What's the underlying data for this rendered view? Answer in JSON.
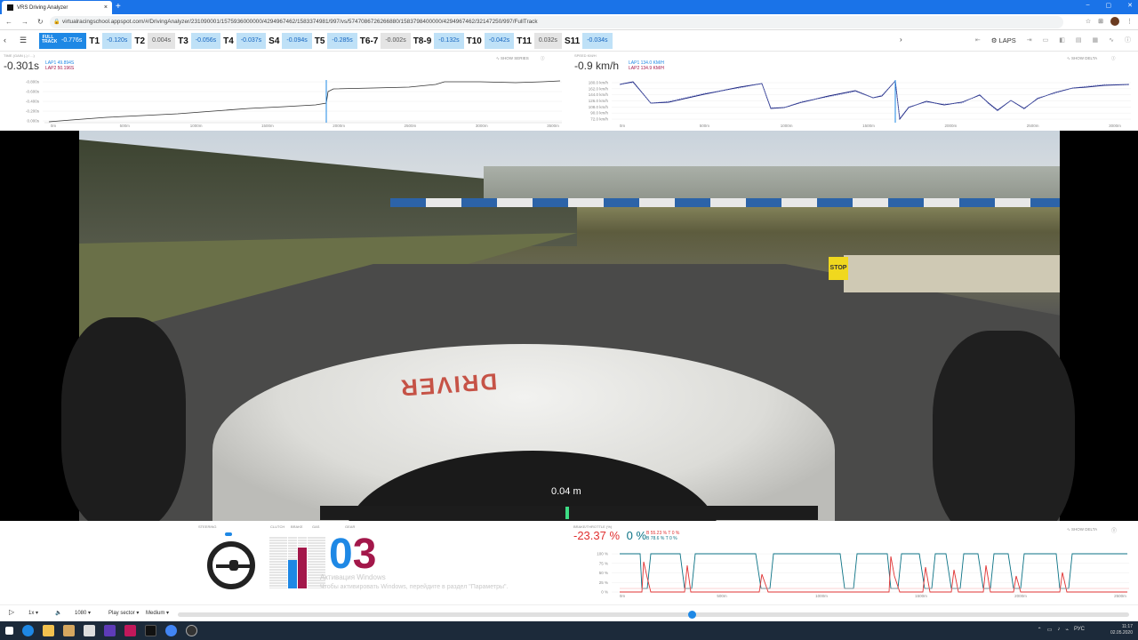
{
  "browser": {
    "tab_title": "VRS Driving Analyzer",
    "tab_close": "×",
    "new_tab": "+",
    "win_controls": [
      "–",
      "▢",
      "✕"
    ],
    "nav": [
      "←",
      "→",
      "↻"
    ],
    "url": "virtualracingschool.appspot.com/#/DrivingAnalyzer/231090001/1575936000000/4294967462/1583374981/997/vs/5747086726266880/1583798400000/4294967462/32147250/997/FullTrack",
    "lock_icon": "🔒",
    "right_icons": [
      "☆",
      "⊞",
      "⋮"
    ]
  },
  "sectorbar": {
    "menu_icon": "☰",
    "sectors": [
      {
        "name": "FULL TRACK",
        "value": "-0.776s",
        "style": "full"
      },
      {
        "name": "T1",
        "value": "-0.120s",
        "style": "b"
      },
      {
        "name": "T2",
        "value": "0.004s",
        "style": "g"
      },
      {
        "name": "T3",
        "value": "-0.056s",
        "style": "b"
      },
      {
        "name": "T4",
        "value": "-0.037s",
        "style": "b"
      },
      {
        "name": "S4",
        "value": "-0.094s",
        "style": "b"
      },
      {
        "name": "T5",
        "value": "-0.285s",
        "style": "b"
      },
      {
        "name": "T6-7",
        "value": "-0.002s",
        "style": "g"
      },
      {
        "name": "T8-9",
        "value": "-0.132s",
        "style": "b"
      },
      {
        "name": "T10",
        "value": "-0.042s",
        "style": "b"
      },
      {
        "name": "T11",
        "value": "0.032s",
        "style": "g"
      },
      {
        "name": "S11",
        "value": "-0.034s",
        "style": "b"
      }
    ],
    "chevron": "›",
    "laps_label": "LAPS",
    "right_icons": [
      "⇤",
      "⇥",
      "▭",
      "◧",
      "▤",
      "▦",
      "∿",
      "ⓘ"
    ]
  },
  "time_chart": {
    "label": "TIME (GAIN (-) / ...)",
    "big": "-0.301s",
    "lap1": "LAP1 49.894S",
    "lap2": "LAP2 50.196S",
    "option": "SHOW SERIES",
    "yticks": [
      "-0.800s",
      "-0.600s",
      "-0.400s",
      "-0.200s",
      "0.000s"
    ],
    "xticks": [
      "0m",
      "500m",
      "1000m",
      "1500m",
      "2000m",
      "2500m",
      "3000m",
      "3500m"
    ],
    "line_color": "#333333",
    "cursor_color": "#1e88e5"
  },
  "speed_chart": {
    "label": "SPEED KM/H",
    "big": "-0.9 km/h",
    "lap1": "LAP1 134.0 KM/H",
    "lap2": "LAP2 134.9 KM/H",
    "option": "SHOW DELTA",
    "yticks": [
      "180.0 km/h",
      "162.0 km/h",
      "144.0 km/h",
      "126.0 km/h",
      "108.0 km/h",
      "90.0 km/h",
      "72.0 km/h"
    ],
    "xticks": [
      "0m",
      "500m",
      "1000m",
      "1500m",
      "2000m",
      "2500m",
      "3000m"
    ],
    "line_color": "#1a237e",
    "cursor_color": "#1e88e5"
  },
  "video": {
    "distance": "0.04 m",
    "sign_text": "STOP",
    "livery_text": "DRIVER"
  },
  "telemetry": {
    "steering_label": "STEERING",
    "clutch_label": "CLUTCH",
    "brake_label": "BRAKE",
    "gas_label": "GAS",
    "gear_label": "GEAR",
    "gear_lap1": "0",
    "gear_lap2": "3",
    "clutch": 0.0,
    "brake_lap1": 0.55,
    "brake_lap2": 0.79,
    "colors": {
      "lap1": "#1e88e5",
      "lap2": "#a3174a"
    }
  },
  "brake_chart": {
    "label": "BRAKE/THROTTLE (%)",
    "big_red": "-23.37 %",
    "big_teal": "0 %",
    "leg1": "B 55.23 % T 0 %",
    "leg2": "B 78.6 % T 0 %",
    "option": "SHOW DELTA",
    "yticks": [
      "100 %",
      "75 %",
      "50 %",
      "25 %",
      "0 %"
    ],
    "xticks": [
      "0m",
      "500m",
      "1000m",
      "1500m",
      "2000m",
      "2500m"
    ],
    "colors": {
      "throttle": "#0b7285",
      "brake": "#e03131"
    }
  },
  "watermark": {
    "line1": "Активация Windows",
    "line2": "Чтобы активировать Windows, перейдите в раздел \"Параметры\"."
  },
  "controls": {
    "play_icon": "▷",
    "speed": "1x ▾",
    "volume_icon": "🔈",
    "quality": "1080 ▾",
    "play_sector": "Play sector ▾",
    "medium": "Medium ▾",
    "progress": 0.54
  },
  "taskbar": {
    "lang": "РУС",
    "time": "11:17",
    "date": "02.05.2020",
    "tray": [
      "⌃",
      "▭",
      "♪",
      "⌁"
    ]
  }
}
